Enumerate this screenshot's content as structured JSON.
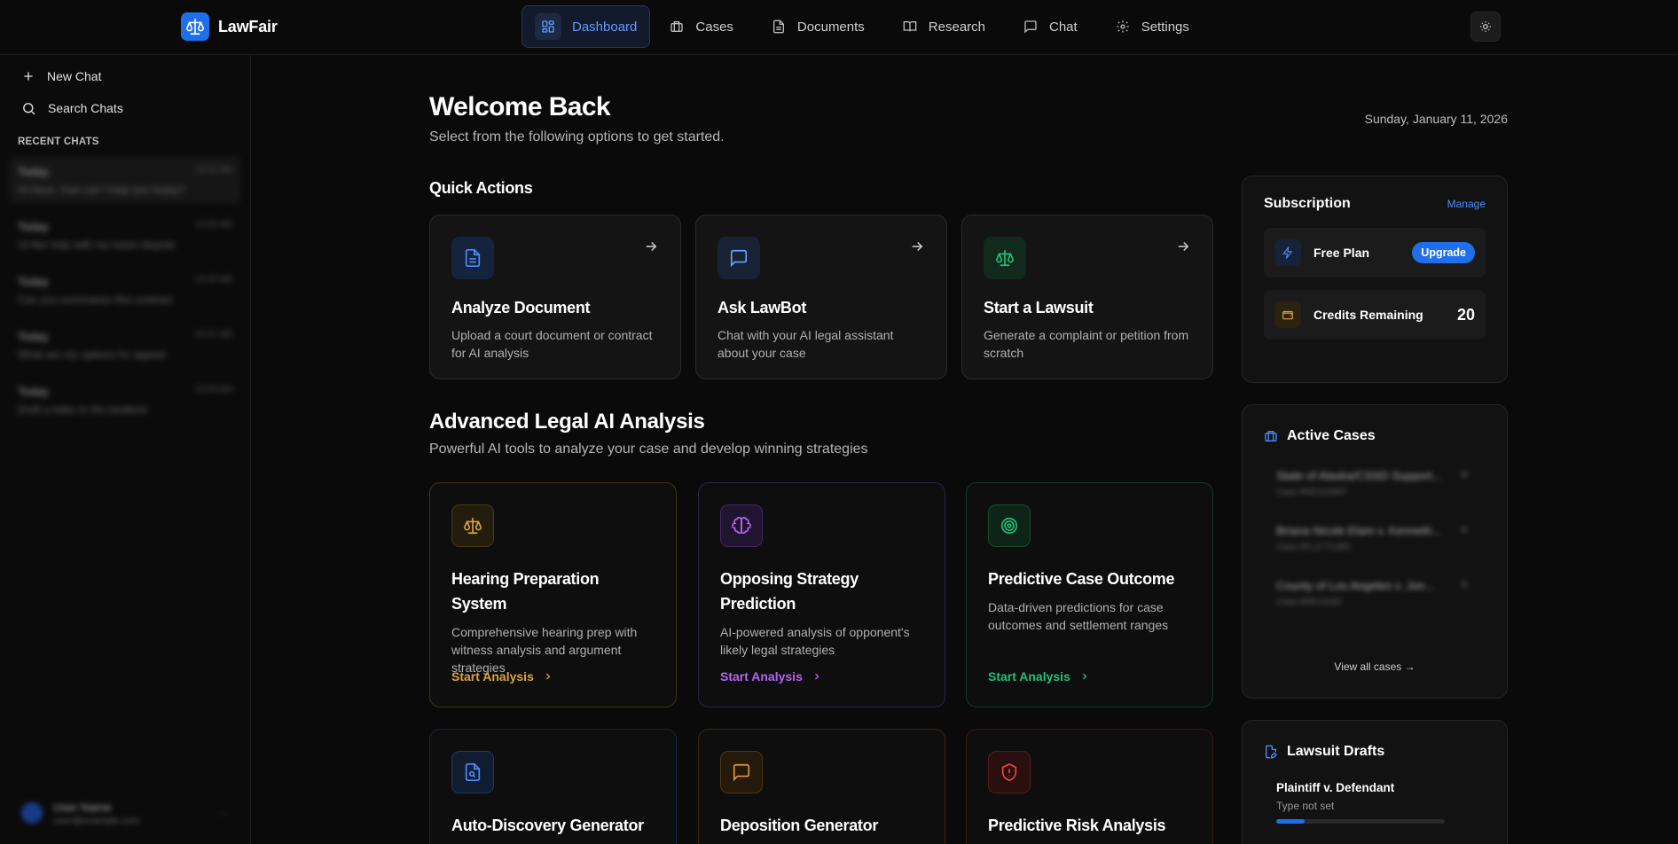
{
  "brand": {
    "name": "LawFair"
  },
  "nav": {
    "items": [
      {
        "label": "Dashboard",
        "icon": "dashboard-icon"
      },
      {
        "label": "Cases",
        "icon": "briefcase-icon"
      },
      {
        "label": "Documents",
        "icon": "file-icon"
      },
      {
        "label": "Research",
        "icon": "book-icon"
      },
      {
        "label": "Chat",
        "icon": "chat-icon"
      },
      {
        "label": "Settings",
        "icon": "gear-icon"
      }
    ],
    "active": "Dashboard"
  },
  "sidebar": {
    "new_chat": "New Chat",
    "search_chats": "Search Chats",
    "recent_label": "RECENT CHATS",
    "chats": [
      {
        "title": "Today",
        "time": "11:02 AM",
        "preview": "Hi there, how can I help you today?"
      },
      {
        "title": "Today",
        "time": "10:54 AM",
        "preview": "I'd like help with my lease dispute"
      },
      {
        "title": "Today",
        "time": "10:40 AM",
        "preview": "Can you summarize this contract"
      },
      {
        "title": "Today",
        "time": "10:21 AM",
        "preview": "What are my options for appeal"
      },
      {
        "title": "Today",
        "time": "10:05 AM",
        "preview": "Draft a letter to the landlord"
      }
    ],
    "user": {
      "name": "User Name",
      "email": "user@example.com"
    }
  },
  "main": {
    "welcome_title": "Welcome Back",
    "welcome_sub": "Select from the following options to get started.",
    "date": "Sunday, January 11, 2026",
    "quick_actions_title": "Quick Actions",
    "quick_actions": [
      {
        "title": "Analyze Document",
        "desc": "Upload a court document or contract for AI analysis",
        "icon": "document-icon"
      },
      {
        "title": "Ask LawBot",
        "desc": "Chat with your AI legal assistant about your case",
        "icon": "message-icon"
      },
      {
        "title": "Start a Lawsuit",
        "desc": "Generate a complaint or petition from scratch",
        "icon": "scale-icon"
      }
    ],
    "advanced_title": "Advanced Legal AI Analysis",
    "advanced_sub": "Powerful AI tools to analyze your case and develop winning strategies",
    "advanced": [
      {
        "title": "Hearing Preparation System",
        "desc": "Comprehensive hearing prep with witness analysis and argument strategies",
        "cta": "Start Analysis",
        "color": "#d9a441",
        "icon": "scale-icon"
      },
      {
        "title": "Opposing Strategy Prediction",
        "desc": "AI-powered analysis of opponent's likely legal strategies",
        "cta": "Start Analysis",
        "color": "#b465f0",
        "icon": "brain-icon"
      },
      {
        "title": "Predictive Case Outcome",
        "desc": "Data-driven predictions for case outcomes and settlement ranges",
        "cta": "Start Analysis",
        "color": "#22c07a",
        "icon": "target-icon"
      },
      {
        "title": "Auto-Discovery Generator",
        "desc": "",
        "cta": "",
        "color": "#4d8dff",
        "icon": "file-search-icon"
      },
      {
        "title": "Deposition Generator",
        "desc": "",
        "cta": "",
        "color": "#e09a2a",
        "icon": "message-icon"
      },
      {
        "title": "Predictive Risk Analysis",
        "desc": "",
        "cta": "",
        "color": "#ef4444",
        "icon": "shield-alert-icon"
      }
    ]
  },
  "subscription": {
    "title": "Subscription",
    "manage": "Manage",
    "plan": "Free Plan",
    "upgrade": "Upgrade",
    "credits_label": "Credits Remaining",
    "credits": "20"
  },
  "active_cases": {
    "title": "Active Cases",
    "items": [
      {
        "name": "State of Alaska/CSSD Support...",
        "number": "Case #NO123457"
      },
      {
        "name": "Briana Nicole Elam v. Kenneth...",
        "number": "Case #FL17712B0"
      },
      {
        "name": "County of Los Angeles v. Jon...",
        "number": "Case #RE21530"
      }
    ],
    "view_all": "View all cases →"
  },
  "lawsuit_drafts": {
    "title": "Lawsuit Drafts",
    "items": [
      {
        "title": "Plaintiff v. Defendant",
        "type": "Type not set",
        "progress": 0.17
      }
    ]
  },
  "colors": {
    "accent": "#1f6feb",
    "background": "#0a0a0a",
    "card": "#141414"
  }
}
